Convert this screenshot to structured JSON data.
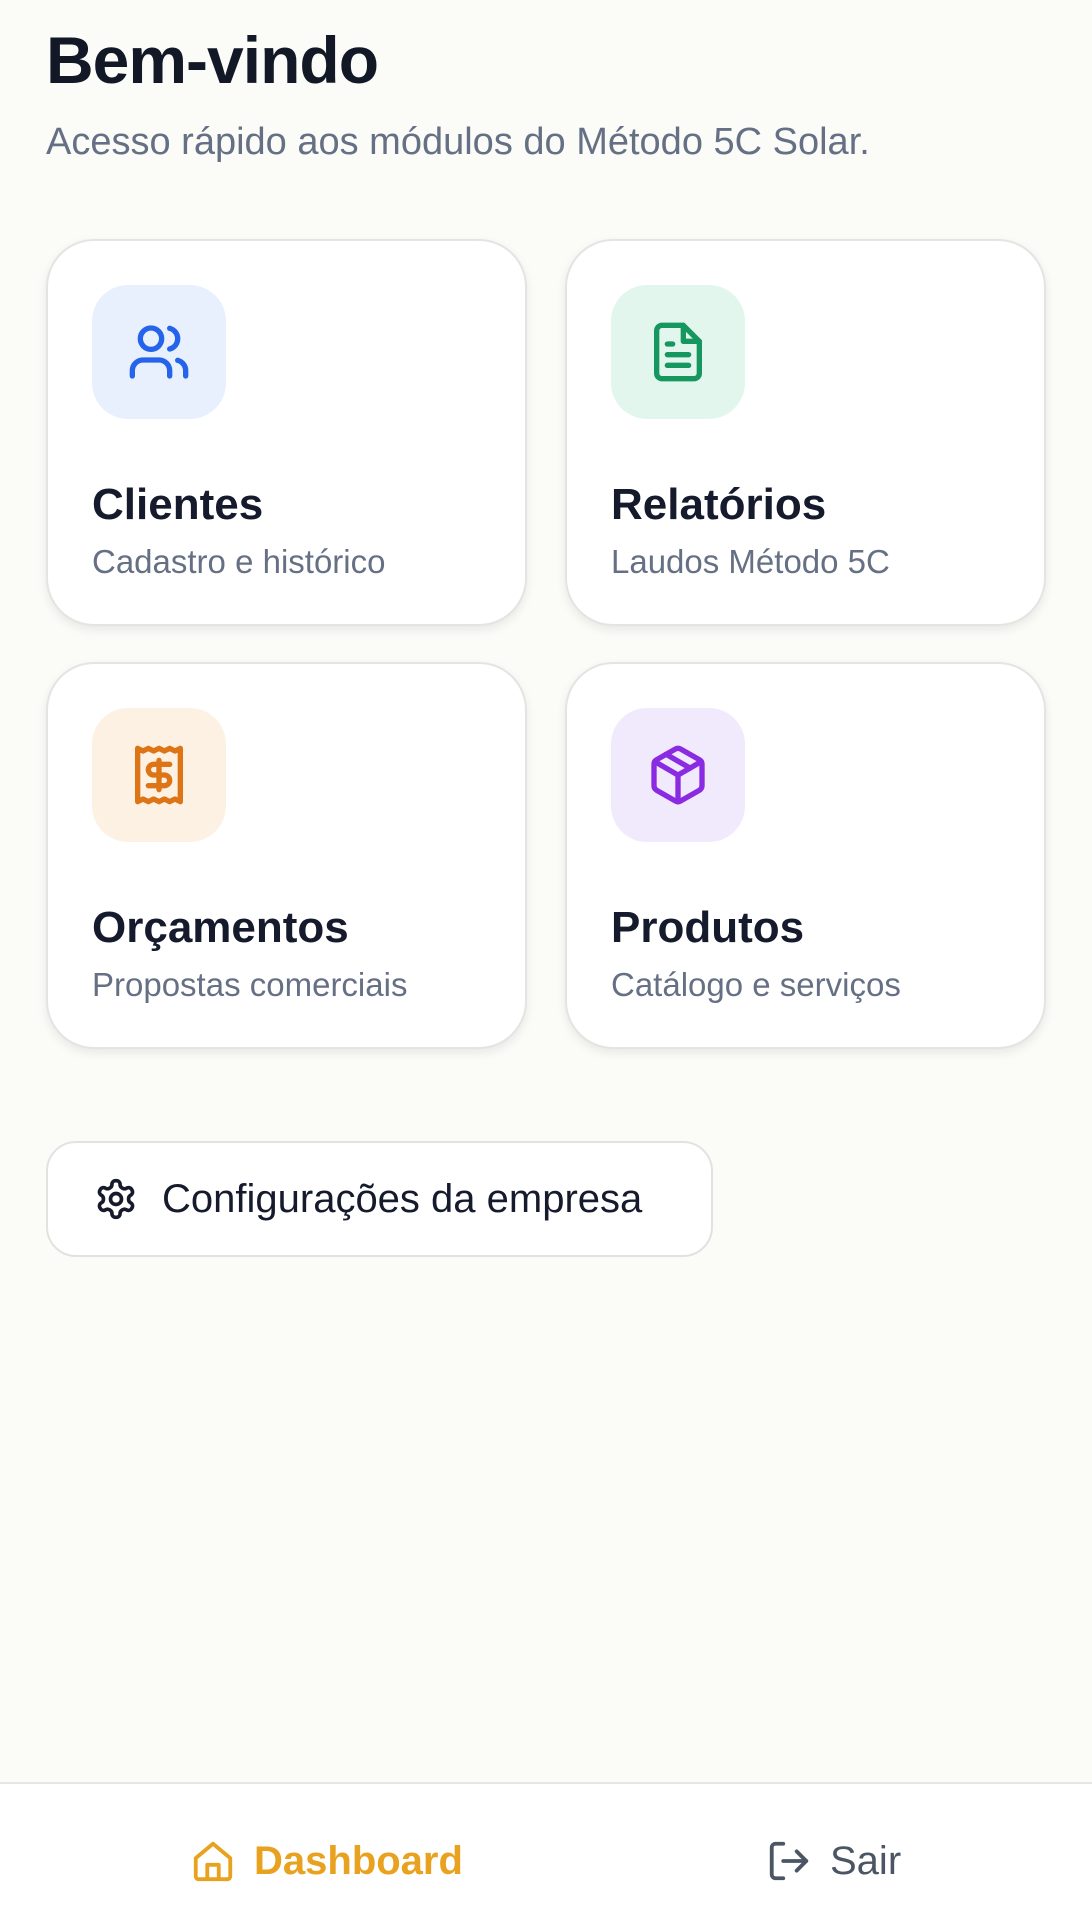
{
  "header": {
    "title": "Bem-vindo",
    "subtitle": "Acesso rápido aos módulos do Método 5C Solar."
  },
  "modules": [
    {
      "title": "Clientes",
      "description": "Cadastro e histórico",
      "icon": "users-icon",
      "icon_color": "#2563eb",
      "icon_bg": "#e8f0fe"
    },
    {
      "title": "Relatórios",
      "description": "Laudos Método 5C",
      "icon": "document-icon",
      "icon_color": "#16975f",
      "icon_bg": "#e3f6ee"
    },
    {
      "title": "Orçamentos",
      "description": "Propostas comerciais",
      "icon": "receipt-dollar-icon",
      "icon_color": "#dd7415",
      "icon_bg": "#fdf1e4"
    },
    {
      "title": "Produtos",
      "description": "Catálogo e serviços",
      "icon": "package-icon",
      "icon_color": "#8a2be2",
      "icon_bg": "#f0eafc"
    }
  ],
  "settings": {
    "label": "Configurações da empresa",
    "icon": "gear-icon"
  },
  "bottom_nav": {
    "dashboard": {
      "label": "Dashboard",
      "icon": "home-icon",
      "active": true,
      "color": "#e9a21f"
    },
    "logout": {
      "label": "Sair",
      "icon": "logout-icon",
      "color": "#4b5563"
    }
  }
}
